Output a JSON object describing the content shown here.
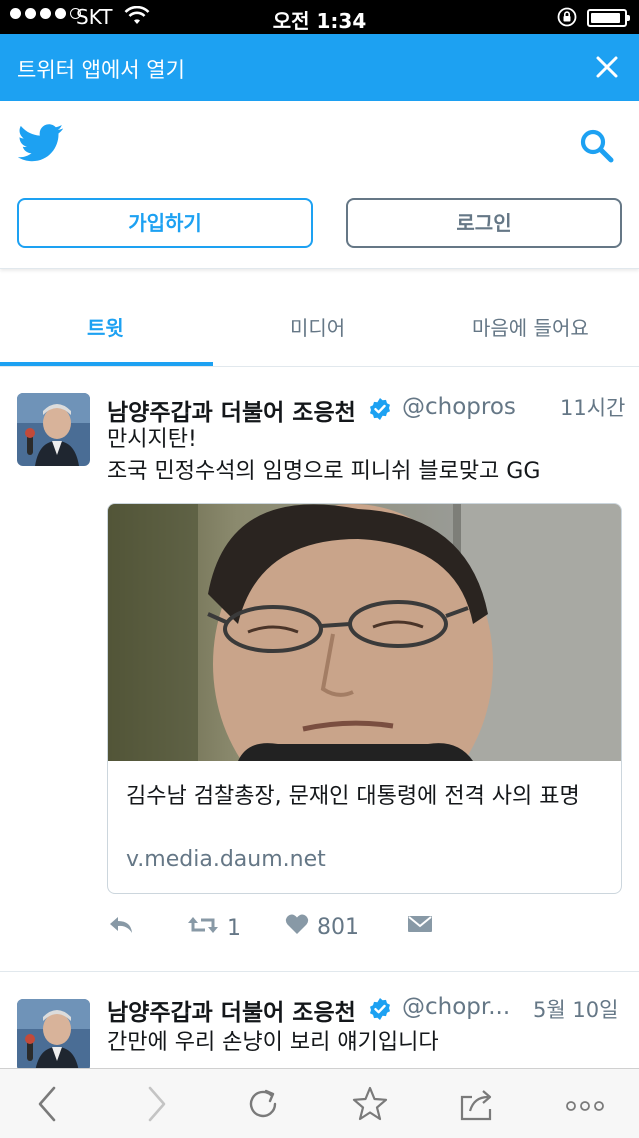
{
  "status_bar": {
    "carrier": "SKT",
    "time": "오전 1:34",
    "battery_level": 0.9
  },
  "open_app_banner": {
    "text": "트위터 앱에서 열기"
  },
  "header": {
    "signup_label": "가입하기",
    "login_label": "로그인"
  },
  "tabs": [
    {
      "label": "트윗",
      "active": true
    },
    {
      "label": "미디어",
      "active": false
    },
    {
      "label": "마음에 들어요",
      "active": false
    }
  ],
  "tweets": [
    {
      "author": "남양주갑과 더불어 조응천",
      "handle": "@chopros",
      "time": "11시간",
      "text_lines": [
        "만시지탄!",
        "조국 민정수석의 임명으로 피니쉬 블로맞고 GG"
      ],
      "card": {
        "title": "김수남 검찰총장, 문재인 대통령에 전격 사의 표명",
        "domain": "v.media.daum.net"
      },
      "retweets": "1",
      "likes": "801"
    },
    {
      "author": "남양주갑과 더불어 조응천",
      "handle": "@chopr...",
      "time": "5월 10일",
      "text_lines": [
        "간만에 우리 손냥이 보리 얘기입니다"
      ]
    }
  ],
  "colors": {
    "twitter_blue": "#1da1f2",
    "gray_text": "#657786",
    "border": "#e1e8ed"
  }
}
